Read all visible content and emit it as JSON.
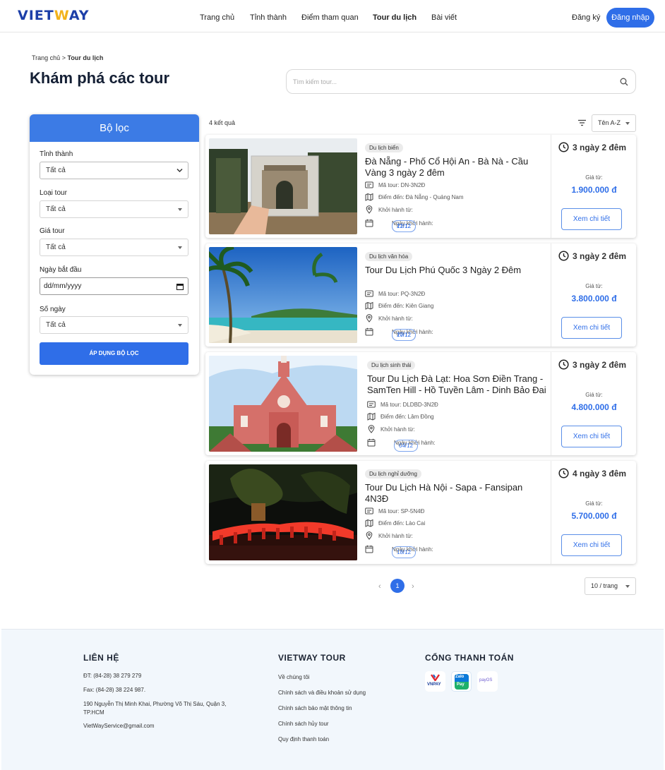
{
  "header": {
    "logo_left": "VIET",
    "logo_mid": "W",
    "logo_right": "AY",
    "nav": [
      "Trang chủ",
      "Tỉnh thành",
      "Điểm tham quan",
      "Tour du lịch",
      "Bài viết"
    ],
    "register": "Đăng ký",
    "login": "Đăng nhập"
  },
  "breadcrumb": {
    "home": "Trang chủ",
    "sep": ">",
    "current": "Tour du lịch"
  },
  "page_title": "Khám phá các tour",
  "search": {
    "placeholder": "Tìm kiếm tour..."
  },
  "filter": {
    "title": "Bộ lọc",
    "province_label": "Tỉnh thành",
    "province_value": "Tất cả",
    "type_label": "Loại tour",
    "type_value": "Tất cả",
    "price_label": "Giá tour",
    "price_value": "Tất cả",
    "start_label": "Ngày bắt đầu",
    "start_placeholder": "dd/mm/yyyy",
    "days_label": "Số ngày",
    "days_value": "Tất cả",
    "apply": "ÁP DỤNG BỘ LỌC"
  },
  "results": {
    "count": "4 kết quả",
    "sort": "Tên A-Z"
  },
  "tours": [
    {
      "category": "Du lịch biển",
      "name": "Đà Nẵng - Phố Cổ Hội An - Bà Nà - Cầu Vàng 3 ngày 2 đêm",
      "code": "Mã tour: DN-3N2Đ",
      "dest": "Điểm đến: Đà Nẵng - Quảng Nam",
      "depart": "Khởi hành từ:",
      "dates_label": "Ngày khởi hành:",
      "dates": [
        "12/12",
        "21/12"
      ],
      "duration": "3 ngày 2 đêm",
      "from": "Giá từ:",
      "price": "1.900.000 đ",
      "detail": "Xem chi tiết"
    },
    {
      "category": "Du lịch văn hóa",
      "name": "Tour Du Lịch Phú Quốc 3 Ngày 2 Đêm",
      "code": "Mã tour: PQ-3N2Đ",
      "dest": "Điểm đến: Kiên Giang",
      "depart": "Khởi hành từ:",
      "dates_label": "Ngày khởi hành:",
      "dates": [
        "17/12",
        "20/12"
      ],
      "duration": "3 ngày 2 đêm",
      "from": "Giá từ:",
      "price": "3.800.000 đ",
      "detail": "Xem chi tiết"
    },
    {
      "category": "Du lịch sinh thái",
      "name": "Tour Du Lịch Đà Lạt: Hoa Sơn Điền Trang - SamTen Hill - Hồ Tuyền Lâm - Dinh Bảo Đại 3N2Đ",
      "code": "Mã tour: DLDBD-3N2Đ",
      "dest": "Điểm đến: Lâm Đồng",
      "depart": "Khởi hành từ:",
      "dates_label": "Ngày khởi hành:",
      "dates": [
        "04/12"
      ],
      "duration": "3 ngày 2 đêm",
      "from": "Giá từ:",
      "price": "4.800.000 đ",
      "detail": "Xem chi tiết"
    },
    {
      "category": "Du lịch nghỉ dưỡng",
      "name": "Tour Du Lịch Hà Nội - Sapa - Fansipan 4N3Đ",
      "code": "Mã tour: SP-5N4Đ",
      "dest": "Điểm đến: Lào Cai",
      "depart": "Khởi hành từ:",
      "dates_label": "Ngày khởi hành:",
      "dates": [
        "18/12"
      ],
      "duration": "4 ngày 3 đêm",
      "from": "Giá từ:",
      "price": "5.700.000 đ",
      "detail": "Xem chi tiết"
    }
  ],
  "pagination": {
    "prev": "‹",
    "current": "1",
    "next": "›",
    "per_page": "10 / trang"
  },
  "footer": {
    "contact_title": "LIÊN HỆ",
    "phone": "ĐT: (84-28) 38 279 279",
    "fax": "Fax: (84-28) 38 224 987.",
    "address": "190 Nguyễn Thị Minh Khai, Phường Võ Thị Sáu, Quận 3, TP.HCM",
    "email": "VietWayService@gmail.com",
    "company_title": "VIETWAY TOUR",
    "links": [
      "Về chúng tôi",
      "Chính sách và điều khoản sử dụng",
      "Chính sách bảo mật thông tin",
      "Chính sách hủy tour",
      "Quy định thanh toán"
    ],
    "pay_title": "CỔNG THANH TOÁN",
    "pay": {
      "vnpay": "VNPAY",
      "zalo_top": "Zalo",
      "zalo_bottom": "Pay",
      "payos": "payOS"
    }
  },
  "colors": {
    "primary": "#2f6ee8",
    "filter_header": "#3c7be5",
    "logo": "#1d3fa8",
    "logo_accent": "#f2b21b",
    "footer_bg": "#f2f7fc"
  }
}
